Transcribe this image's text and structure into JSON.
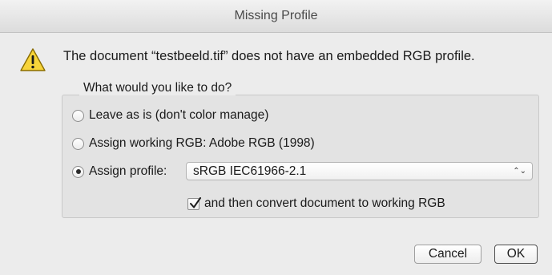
{
  "window": {
    "title": "Missing Profile"
  },
  "message": "The document “testbeeld.tif” does not have an embedded RGB profile.",
  "group": {
    "legend": "What would you like to do?",
    "options": [
      {
        "label": "Leave as is (don't color manage)",
        "selected": false
      },
      {
        "label": "Assign working RGB:  Adobe RGB (1998)",
        "selected": false
      },
      {
        "label": "Assign profile:",
        "selected": true
      }
    ],
    "profile_select": {
      "value": "sRGB IEC61966-2.1",
      "arrows": "⌃⌄"
    },
    "convert_checkbox": {
      "label": "and then convert document to working RGB",
      "checked": true
    }
  },
  "buttons": {
    "cancel": "Cancel",
    "ok": "OK"
  },
  "colors": {
    "warning_fill": "#f7d43a",
    "warning_stroke": "#8a6d00",
    "background": "#ececec"
  },
  "icons": {
    "warning": "warning-triangle-icon"
  }
}
